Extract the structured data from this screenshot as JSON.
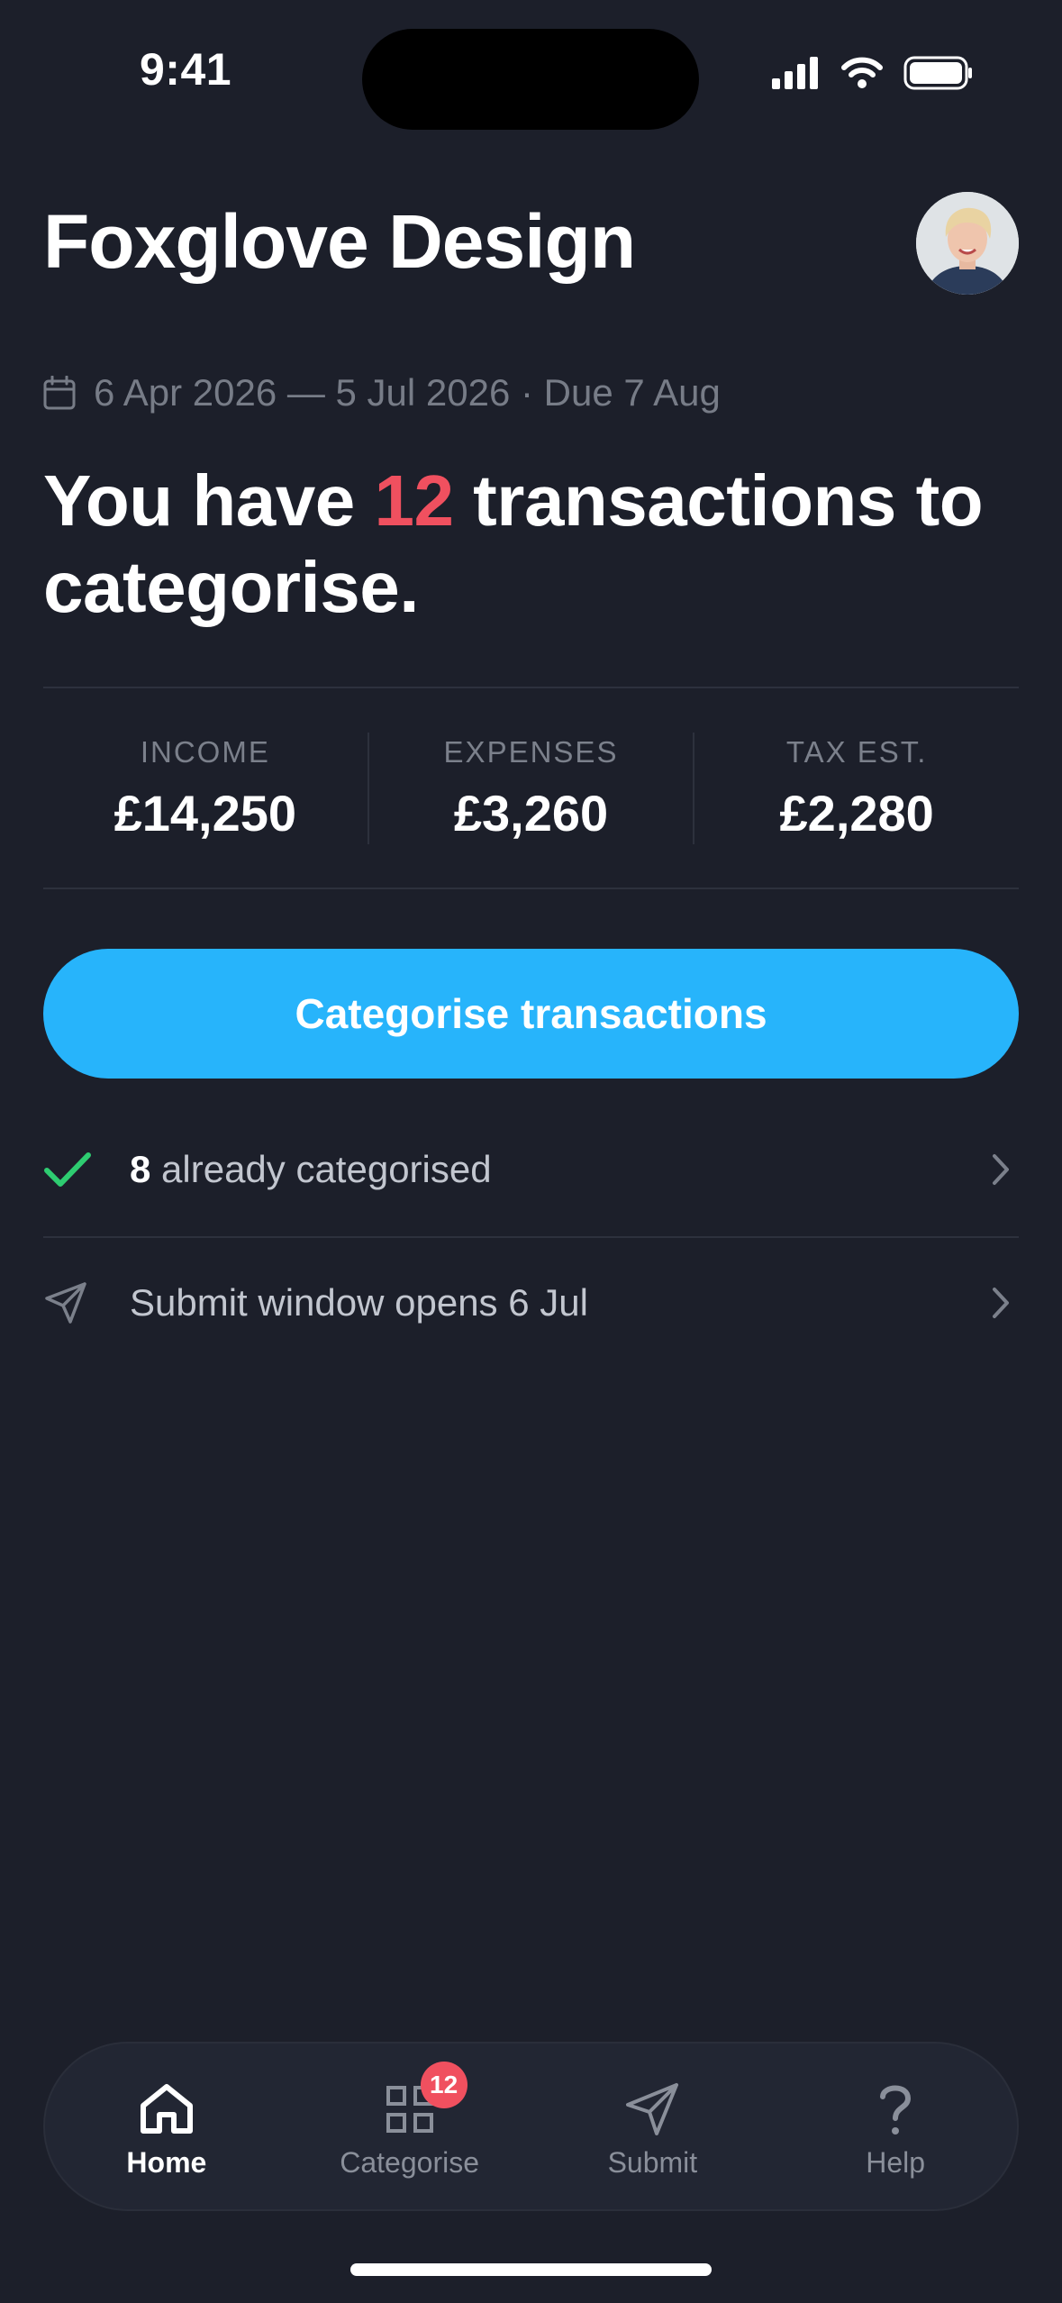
{
  "status_bar": {
    "time": "9:41"
  },
  "header": {
    "company": "Foxglove Design"
  },
  "period": {
    "text": "6 Apr 2026 — 5 Jul 2026 · Due 7 Aug"
  },
  "headline": {
    "prefix": "You have ",
    "count": "12",
    "suffix": " transactions to categorise."
  },
  "stats": [
    {
      "label": "INCOME",
      "value": "£14,250"
    },
    {
      "label": "EXPENSES",
      "value": "£3,260"
    },
    {
      "label": "TAX EST.",
      "value": "£2,280"
    }
  ],
  "cta": {
    "label": "Categorise transactions"
  },
  "rows": {
    "categorised": {
      "count": "8",
      "text": " already categorised"
    },
    "submit": {
      "text": "Submit window opens 6 Jul"
    }
  },
  "tabs": [
    {
      "label": "Home",
      "icon": "home-icon"
    },
    {
      "label": "Categorise",
      "icon": "grid-icon",
      "badge": "12"
    },
    {
      "label": "Submit",
      "icon": "send-icon"
    },
    {
      "label": "Help",
      "icon": "help-icon"
    }
  ],
  "colors": {
    "accent": "#27b4fb",
    "highlight": "#f0505f",
    "success": "#2ecc71",
    "background": "#1c1f2a"
  }
}
